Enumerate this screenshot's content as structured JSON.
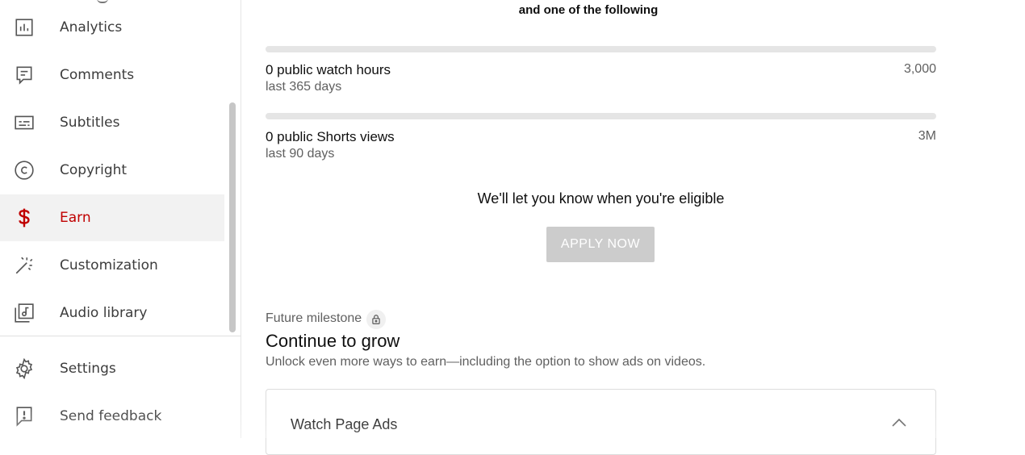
{
  "sidebar": {
    "items": [
      {
        "label": "Analytics",
        "icon": "analytics-icon"
      },
      {
        "label": "Comments",
        "icon": "comments-icon"
      },
      {
        "label": "Subtitles",
        "icon": "subtitles-icon"
      },
      {
        "label": "Copyright",
        "icon": "copyright-icon"
      },
      {
        "label": "Earn",
        "icon": "earn-dollar-icon",
        "active": true
      },
      {
        "label": "Customization",
        "icon": "magic-wand-icon"
      },
      {
        "label": "Audio library",
        "icon": "audio-library-icon"
      },
      {
        "label": "Settings",
        "icon": "gear-icon"
      },
      {
        "label": "Send feedback",
        "icon": "feedback-icon"
      }
    ],
    "active_color": "#c00000"
  },
  "main": {
    "requirement_heading": "and one of the following",
    "metrics": [
      {
        "label": "0 public watch hours",
        "sublabel": "last 365 days",
        "target": "3,000",
        "progress": 0
      },
      {
        "label": "0 public Shorts views",
        "sublabel": "last 90 days",
        "target": "3M",
        "progress": 0
      }
    ],
    "eligible_text": "We'll let you know when you're eligible",
    "apply_button": "APPLY NOW",
    "future": {
      "label": "Future milestone",
      "icon": "lock-icon",
      "title": "Continue to grow",
      "description": "Unlock even more ways to earn—including the option to show ads on videos."
    },
    "card": {
      "title": "Watch Page Ads",
      "icon": "chevron-up-icon"
    }
  }
}
